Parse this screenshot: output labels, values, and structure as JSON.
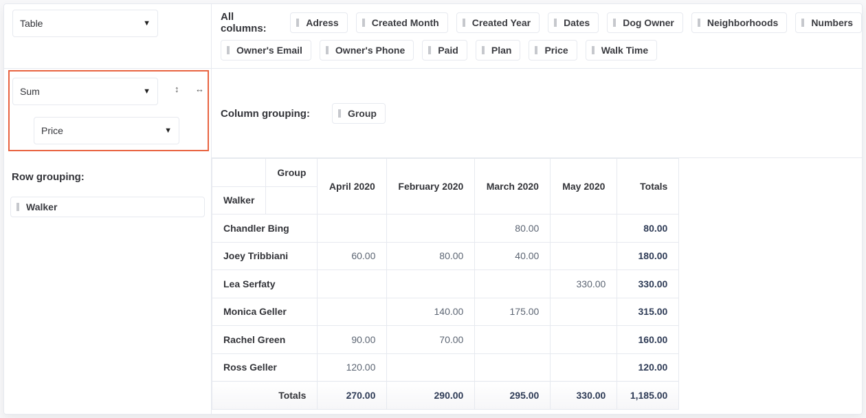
{
  "renderer": {
    "selected": "Table"
  },
  "aggregator": {
    "function": "Sum",
    "field": "Price"
  },
  "aggregator_icons": {
    "row_order": "vertical-arrows-icon",
    "col_order": "horizontal-arrows-icon"
  },
  "accent_color": "#e8623f",
  "all_columns": {
    "label": "All columns:",
    "items": [
      "Adress",
      "Created Month",
      "Created Year",
      "Dates",
      "Dog Owner",
      "Neighborhoods",
      "Numbers",
      "Owner's Email",
      "Owner's Phone",
      "Paid",
      "Plan",
      "Price",
      "Walk Time"
    ]
  },
  "column_grouping": {
    "label": "Column grouping:",
    "items": [
      "Group"
    ]
  },
  "row_grouping": {
    "label": "Row grouping:",
    "items": [
      "Walker"
    ]
  },
  "table": {
    "col_attr": "Group",
    "row_attr": "Walker",
    "columns": [
      "April 2020",
      "February 2020",
      "March 2020",
      "May 2020"
    ],
    "totals_label": "Totals",
    "rows": [
      {
        "name": "Chandler Bing",
        "values": [
          "",
          "",
          "80.00",
          ""
        ],
        "total": "80.00"
      },
      {
        "name": "Joey Tribbiani",
        "values": [
          "60.00",
          "80.00",
          "40.00",
          ""
        ],
        "total": "180.00"
      },
      {
        "name": "Lea Serfaty",
        "values": [
          "",
          "",
          "",
          "330.00"
        ],
        "total": "330.00"
      },
      {
        "name": "Monica Geller",
        "values": [
          "",
          "140.00",
          "175.00",
          ""
        ],
        "total": "315.00"
      },
      {
        "name": "Rachel Green",
        "values": [
          "90.00",
          "70.00",
          "",
          ""
        ],
        "total": "160.00"
      },
      {
        "name": "Ross Geller",
        "values": [
          "120.00",
          "",
          "",
          ""
        ],
        "total": "120.00"
      }
    ],
    "column_totals": [
      "270.00",
      "290.00",
      "295.00",
      "330.00"
    ],
    "grand_total": "1,185.00"
  }
}
